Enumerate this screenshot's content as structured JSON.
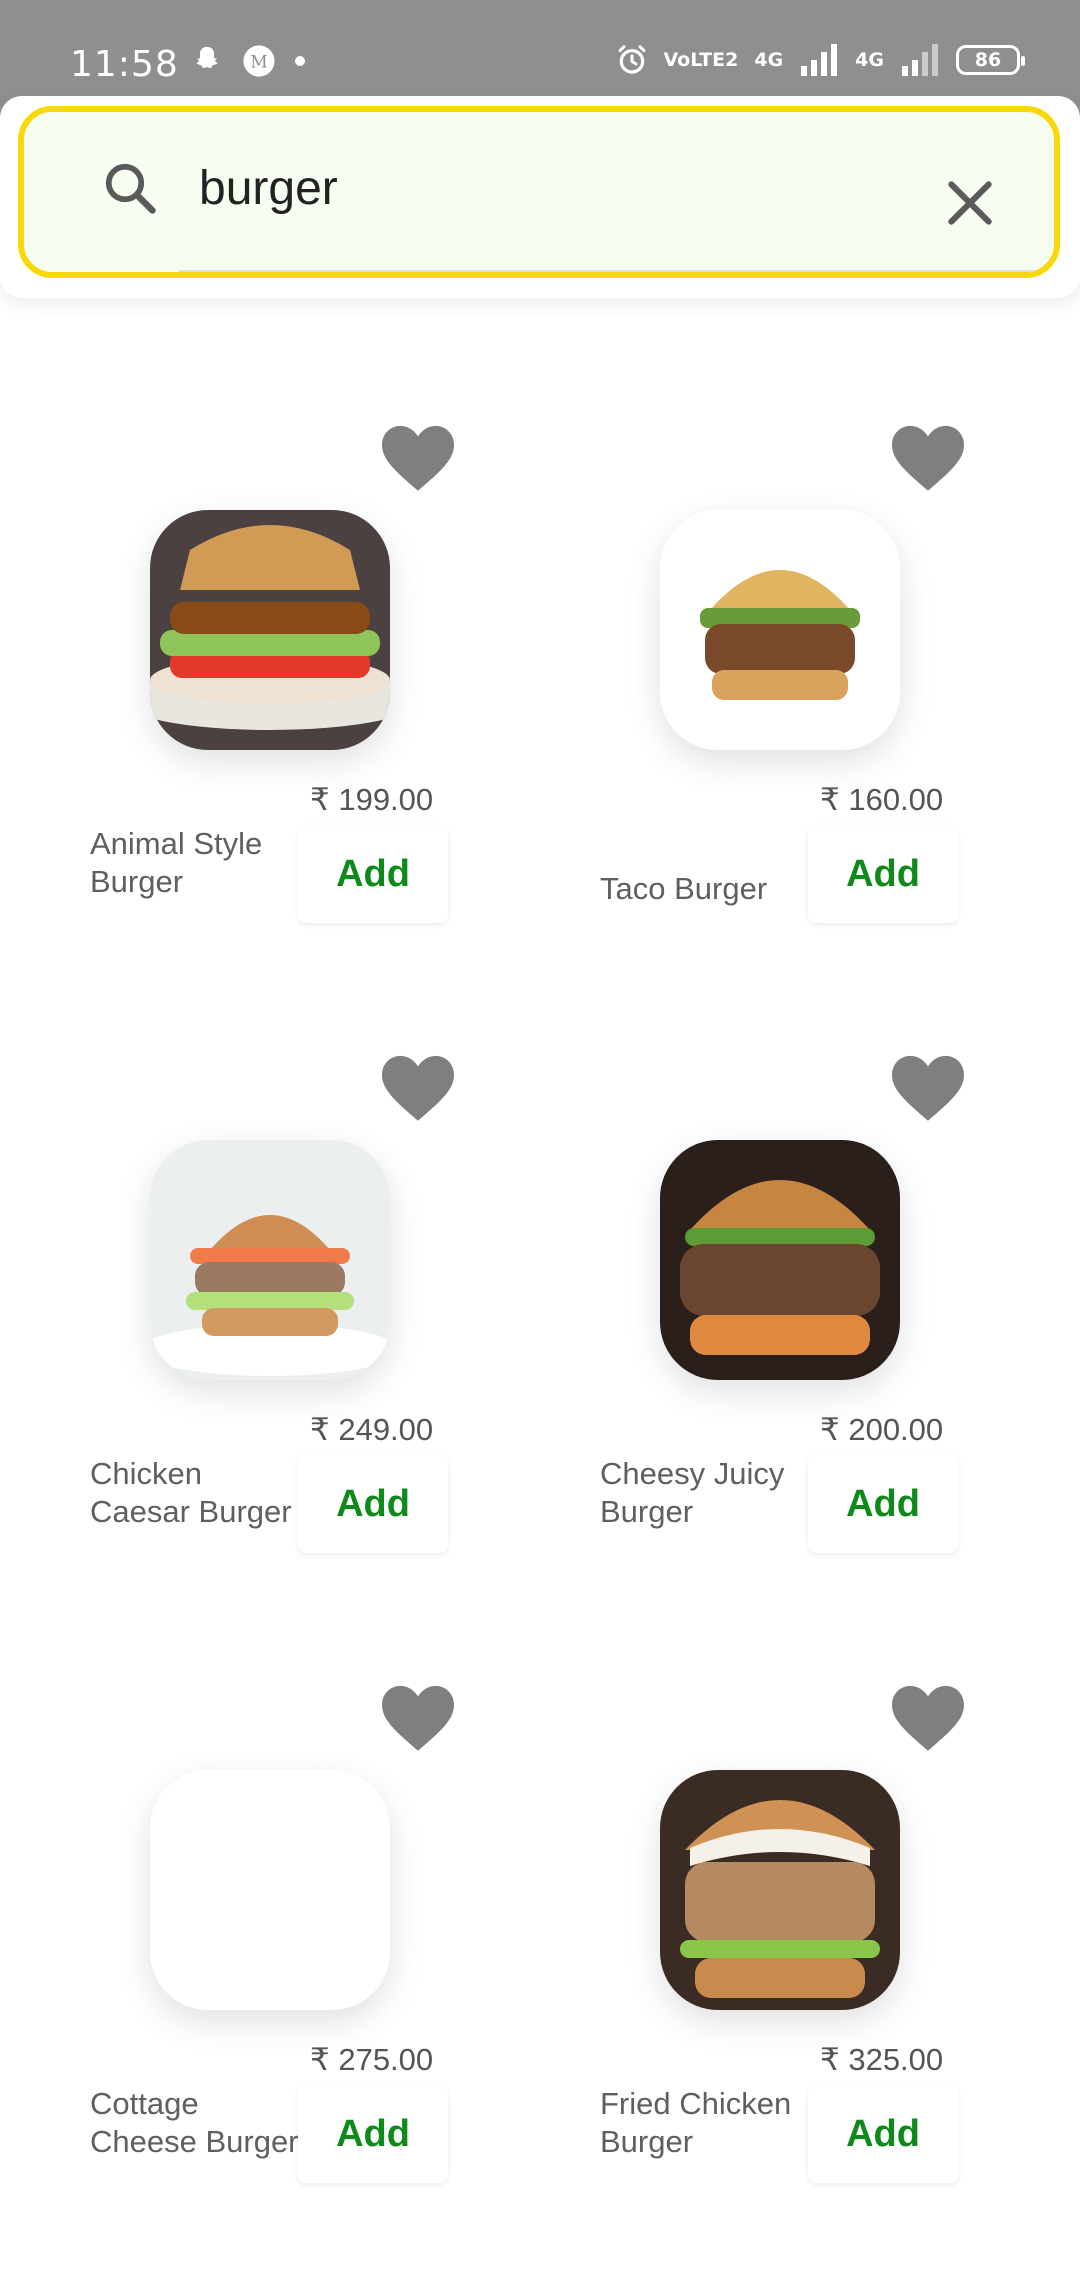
{
  "status_bar": {
    "time": "11:58",
    "left_icons": [
      "snapchat-icon",
      "gmail-icon",
      "dot-icon"
    ],
    "right_icons": [
      "alarm-icon",
      "volte-icon",
      "signal-4g-icon",
      "signal-4g-icon"
    ],
    "volte_label": "VoLTE2",
    "net_label_1": "4G",
    "net_label_2": "4G",
    "battery": "86"
  },
  "search": {
    "value": "burger",
    "placeholder": "",
    "border_color": "#f7d90a",
    "icon": "search-icon",
    "clear_icon": "close-icon"
  },
  "products": [
    {
      "name": "Animal Style Burger",
      "price": "₹ 199.00",
      "add_label": "Add"
    },
    {
      "name": "Taco Burger",
      "price": "₹ 160.00",
      "add_label": "Add"
    },
    {
      "name": "Chicken Caesar Burger",
      "price": "₹ 249.00",
      "add_label": "Add"
    },
    {
      "name": "Cheesy Juicy Burger",
      "price": "₹ 200.00",
      "add_label": "Add"
    },
    {
      "name": "Cottage Cheese Burger",
      "price": "₹ 275.00",
      "add_label": "Add"
    },
    {
      "name": "Fried Chicken Burger",
      "price": "₹ 325.00",
      "add_label": "Add"
    }
  ],
  "colors": {
    "accent_green": "#0e8a1b",
    "heart_gray": "#7f7f7f"
  }
}
